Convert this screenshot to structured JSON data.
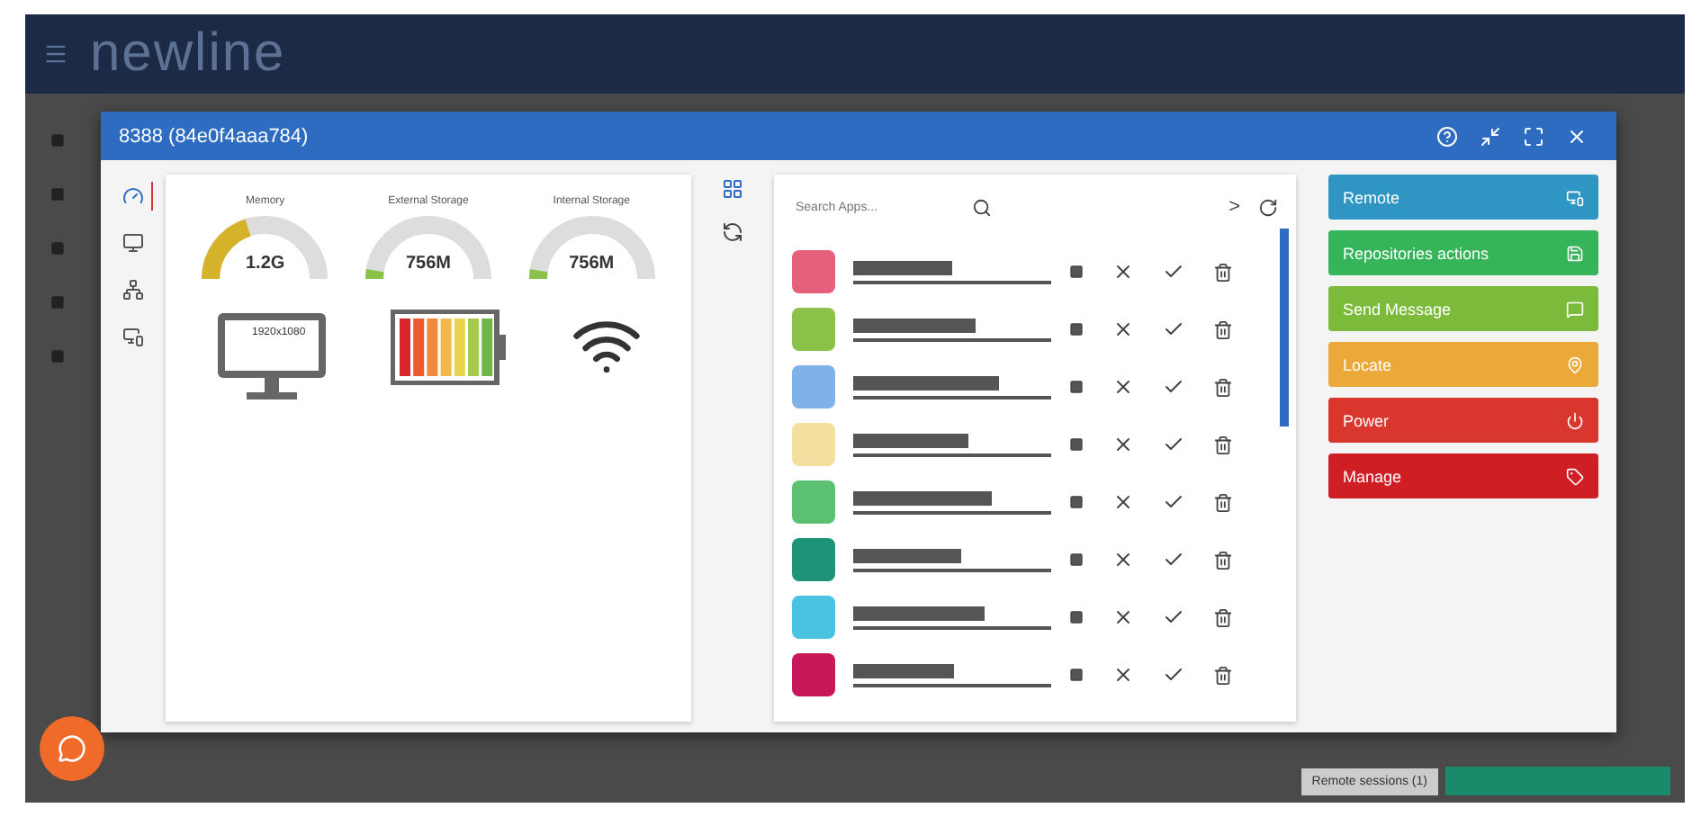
{
  "app": {
    "logo": "newline"
  },
  "dialog": {
    "title": "8388 (84e0f4aaa784)"
  },
  "rail": [
    {
      "kind": "dashboard",
      "selected": true
    },
    {
      "kind": "screen",
      "selected": false
    },
    {
      "kind": "network",
      "selected": false
    },
    {
      "kind": "display",
      "selected": false
    }
  ],
  "gauges": [
    {
      "label": "Memory",
      "value": "1.2G",
      "level": 0.4,
      "color": "#d4b22a"
    },
    {
      "label": "External Storage",
      "value": "756M",
      "level": 0.05,
      "color": "#8bc34a"
    },
    {
      "label": "Internal Storage",
      "value": "756M",
      "level": 0.05,
      "color": "#8bc34a"
    }
  ],
  "display": {
    "resolution": "1920x1080"
  },
  "apps_panel": {
    "search": {
      "placeholder": "Search Apps..."
    },
    "next": ">"
  },
  "apps": [
    {
      "color": "#e5607a"
    },
    {
      "color": "#8bc34a"
    },
    {
      "color": "#7fb3e8"
    },
    {
      "color": "#f3e0a0"
    },
    {
      "color": "#5cc073"
    },
    {
      "color": "#1e9378"
    },
    {
      "color": "#4bc3e0"
    },
    {
      "color": "#c8185a"
    }
  ],
  "actions": [
    {
      "label": "Remote",
      "color": "#2f96c4",
      "kind": "remote"
    },
    {
      "label": "Repositories actions",
      "color": "#35b45a",
      "kind": "save"
    },
    {
      "label": "Send Message",
      "color": "#7cba3c",
      "kind": "message"
    },
    {
      "label": "Locate",
      "color": "#eba93a",
      "kind": "locate"
    },
    {
      "label": "Power",
      "color": "#d9372e",
      "kind": "power"
    },
    {
      "label": "Manage",
      "color": "#cf1f25",
      "kind": "tag"
    }
  ],
  "status": {
    "sessions": "Remote sessions (1)"
  }
}
